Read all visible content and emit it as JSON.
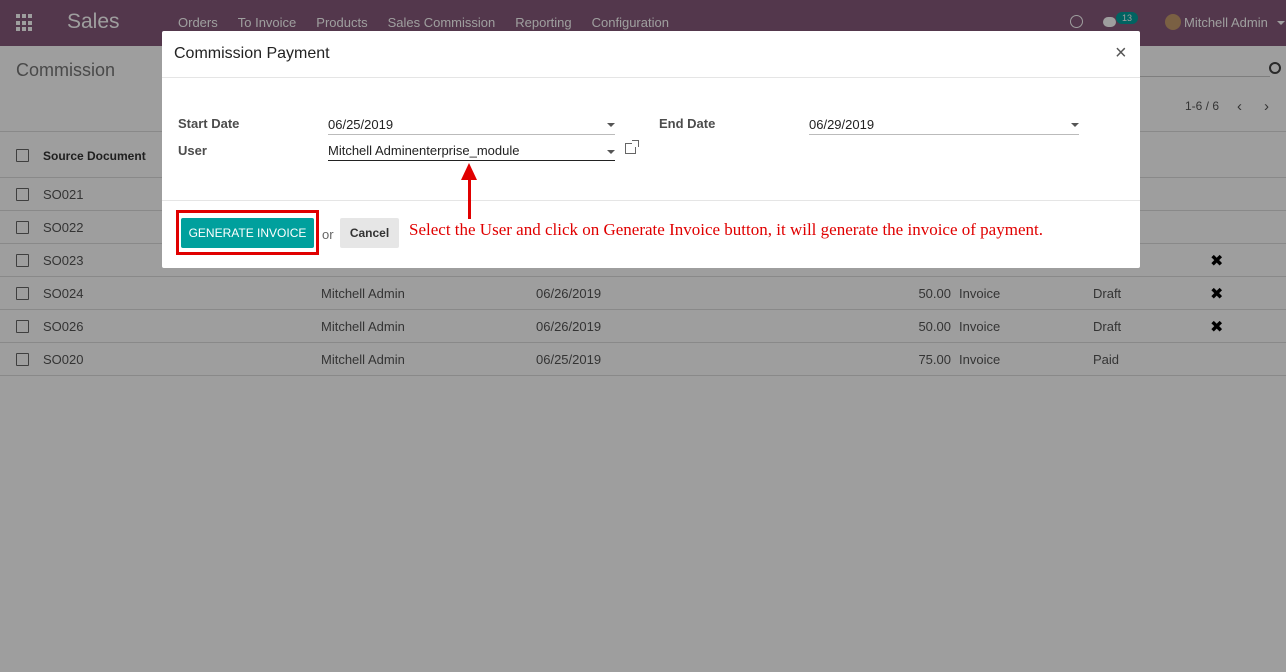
{
  "navbar": {
    "brand": "Sales",
    "menu": [
      "Orders",
      "To Invoice",
      "Products",
      "Sales Commission",
      "Reporting",
      "Configuration"
    ],
    "chat_count": "13",
    "user": "Mitchell Admin"
  },
  "control": {
    "title": "Commission",
    "pager": "1-6 / 6"
  },
  "list": {
    "header": "Source Document",
    "rows": [
      {
        "doc": "SO021",
        "user": "",
        "date": "",
        "amount": "",
        "type": "",
        "state": "",
        "x": ""
      },
      {
        "doc": "SO022",
        "user": "",
        "date": "",
        "amount": "",
        "type": "",
        "state": "",
        "x": ""
      },
      {
        "doc": "SO023",
        "user": "",
        "date": "",
        "amount": "",
        "type": "",
        "state": "",
        "x": "✖"
      },
      {
        "doc": "SO024",
        "user": "Mitchell Admin",
        "date": "06/26/2019",
        "amount": "50.00",
        "type": "Invoice",
        "state": "Draft",
        "x": "✖"
      },
      {
        "doc": "SO026",
        "user": "Mitchell Admin",
        "date": "06/26/2019",
        "amount": "50.00",
        "type": "Invoice",
        "state": "Draft",
        "x": "✖"
      },
      {
        "doc": "SO020",
        "user": "Mitchell Admin",
        "date": "06/25/2019",
        "amount": "75.00",
        "type": "Invoice",
        "state": "Paid",
        "x": ""
      }
    ]
  },
  "modal": {
    "title": "Commission Payment",
    "start_date_label": "Start Date",
    "start_date": "06/25/2019",
    "end_date_label": "End Date",
    "end_date": "06/29/2019",
    "user_label": "User",
    "user_value": "Mitchell Adminenterprise_module",
    "generate_label": "GENERATE INVOICE",
    "or_text": "or",
    "cancel_label": "Cancel",
    "annotation": "Select the User and click on Generate Invoice button, it will generate the invoice of payment."
  },
  "colors": {
    "navbar": "#875a7b",
    "primary": "#00a09d",
    "annotation": "#e00000"
  }
}
